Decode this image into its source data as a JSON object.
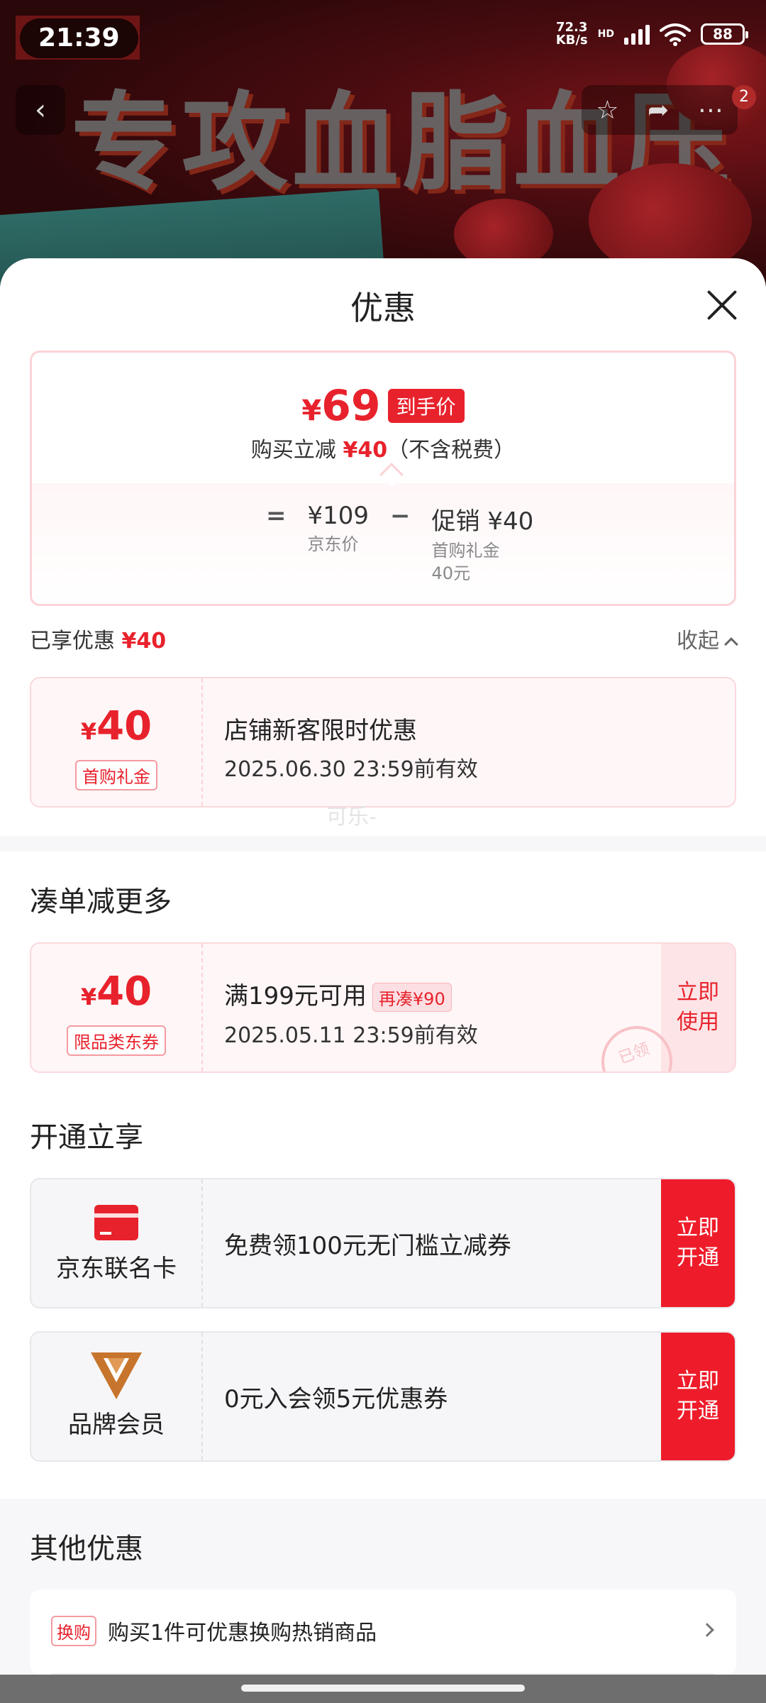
{
  "status_bar": {
    "time": "21:39",
    "net_speed_value": "72.3",
    "net_speed_unit": "KB/s",
    "hd": "HD",
    "battery": "88"
  },
  "background": {
    "banner_text": "专攻血脂血压",
    "nav_badge": "2"
  },
  "sheet": {
    "title": "优惠",
    "price": {
      "symbol": "¥",
      "final": "69",
      "tag": "到手价",
      "reduce_prefix": "购买立减",
      "reduce_amount": "¥40",
      "reduce_suffix": "（不含税费）",
      "equals": "=",
      "base_price": "¥109",
      "base_label": "京东价",
      "minus": "−",
      "promo_price": "促销 ¥40",
      "promo_label": "首购礼金",
      "promo_sub": "40元"
    },
    "enjoyed": {
      "label": "已享优惠",
      "amount": "¥40",
      "collapse": "收起"
    },
    "enjoyed_coupon": {
      "symbol": "¥",
      "amount": "40",
      "type": "首购礼金",
      "title": "店铺新客限时优惠",
      "valid": "2025.06.30 23:59前有效"
    },
    "watermark": "可乐-",
    "more_section": {
      "title": "凑单减更多",
      "coupon": {
        "symbol": "¥",
        "amount": "40",
        "type": "限品类东券",
        "condition": "满199元可用",
        "more_tag": "再凑¥90",
        "valid": "2025.05.11 23:59前有效",
        "button": "立即\n使用",
        "button_line1": "立即",
        "button_line2": "使用",
        "stamp": "已领"
      }
    },
    "open_section": {
      "title": "开通立享",
      "items": [
        {
          "name": "京东联名卡",
          "icon": "credit-card-icon",
          "desc": "免费领100元无门槛立减券",
          "button_line1": "立即",
          "button_line2": "开通"
        },
        {
          "name": "品牌会员",
          "icon": "brand-v-icon",
          "desc": "0元入会领5元优惠券",
          "button_line1": "立即",
          "button_line2": "开通"
        }
      ]
    },
    "other_section": {
      "title": "其他优惠",
      "items": [
        {
          "tag": "换购",
          "text": "购买1件可优惠换购热销商品"
        }
      ]
    }
  },
  "colors": {
    "accent_red": "#e8222c",
    "button_red": "#ee1c2a",
    "light_pink": "#fff6f7"
  }
}
